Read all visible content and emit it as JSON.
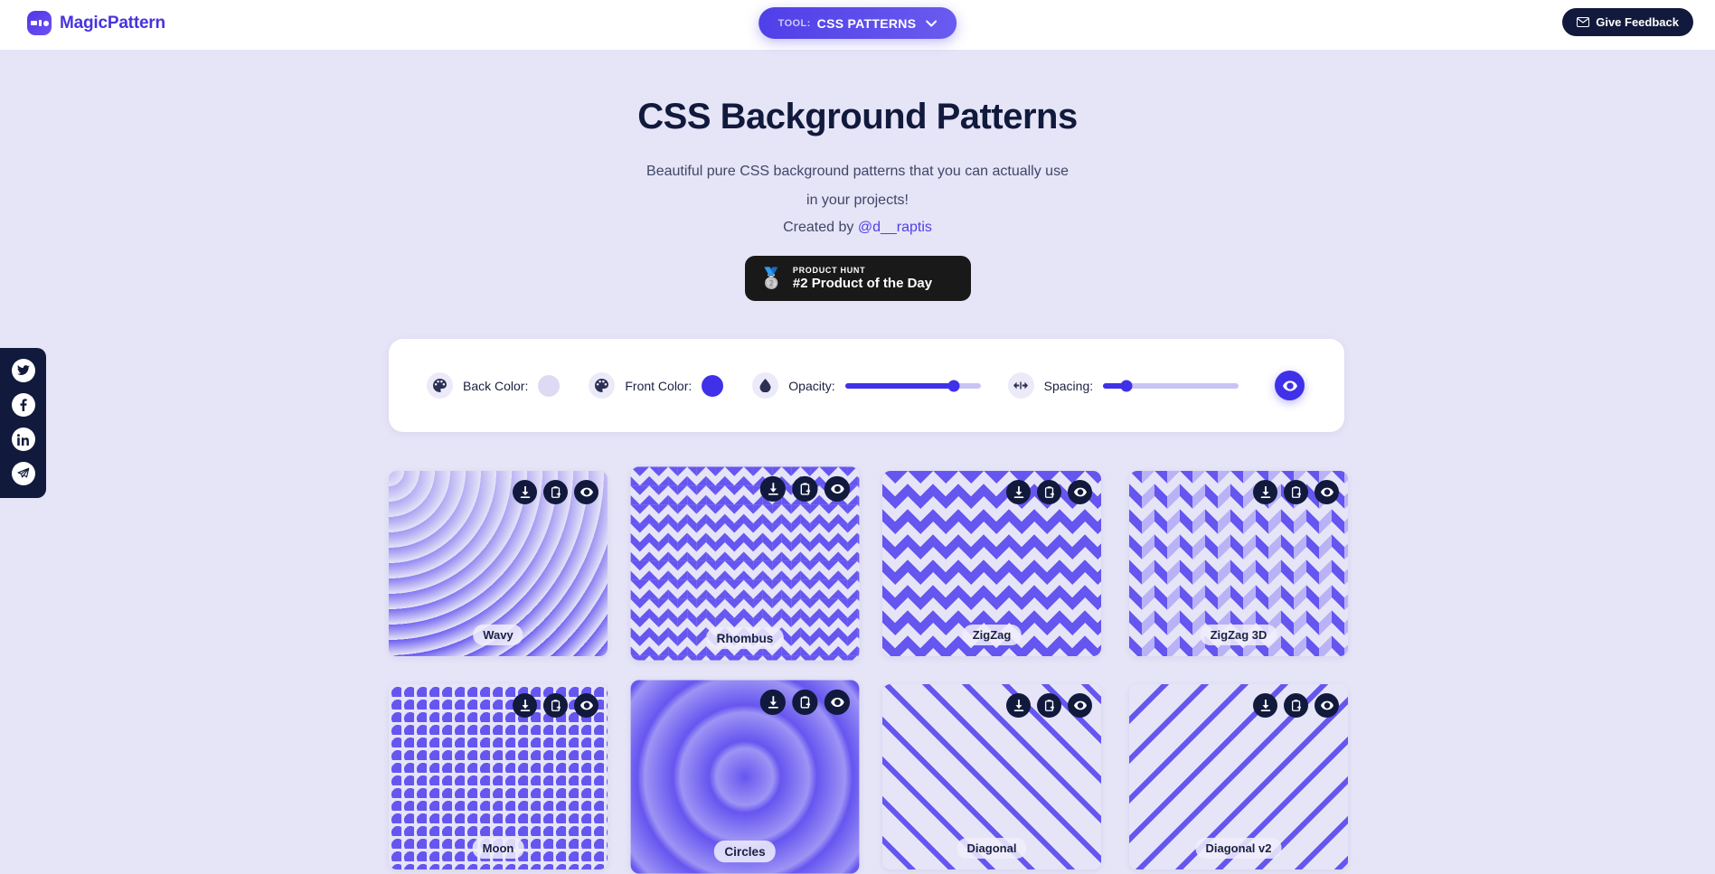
{
  "header": {
    "brand_name": "MagicPattern",
    "tool_label": "TOOL:",
    "tool_value": "CSS PATTERNS",
    "tool_chevron": "chevron-down-icon",
    "feedback_label": "Give Feedback",
    "feedback_icon": "envelope-icon"
  },
  "social": {
    "items": [
      {
        "name": "twitter",
        "glyph": "twitter-icon"
      },
      {
        "name": "facebook",
        "glyph": "facebook-icon"
      },
      {
        "name": "linkedin",
        "glyph": "linkedin-icon"
      },
      {
        "name": "telegram",
        "glyph": "telegram-icon"
      }
    ]
  },
  "hero": {
    "title": "CSS Background Patterns",
    "subtitle": "Beautiful pure CSS background patterns that you can actually use in your projects!",
    "created_prefix": "Created by ",
    "created_handle": "@d__raptis",
    "badge_kicker": "PRODUCT HUNT",
    "badge_title": "#2 Product of the Day",
    "badge_medal": "🥈"
  },
  "controls": {
    "back_color": {
      "label": "Back Color:",
      "value": "#dedaf4",
      "icon": "palette-icon"
    },
    "front_color": {
      "label": "Front Color:",
      "value": "#3f31e8",
      "icon": "palette-icon"
    },
    "opacity": {
      "label": "Opacity:",
      "icon": "droplet-icon",
      "value": 80,
      "min": 0,
      "max": 100
    },
    "spacing": {
      "label": "Spacing:",
      "icon": "horizontal-arrows-icon",
      "value": 17,
      "min": 0,
      "max": 100
    },
    "preview_icon": "eye-icon"
  },
  "card_actions": [
    {
      "name": "download",
      "icon": "download-icon"
    },
    {
      "name": "copy",
      "icon": "clipboard-copy-icon"
    },
    {
      "name": "preview",
      "icon": "eye-icon"
    }
  ],
  "patterns": [
    {
      "label": "Wavy",
      "css": "p-wavy",
      "hovered": false
    },
    {
      "label": "Rhombus",
      "css": "p-rhombus",
      "hovered": true
    },
    {
      "label": "ZigZag",
      "css": "p-zigzag",
      "hovered": false
    },
    {
      "label": "ZigZag 3D",
      "css": "p-zigzag3d",
      "hovered": false
    },
    {
      "label": "Moon",
      "css": "p-moon",
      "hovered": false
    },
    {
      "label": "Circles",
      "css": "p-circles",
      "hovered": true
    },
    {
      "label": "Diagonal",
      "css": "p-diagonal",
      "hovered": false
    },
    {
      "label": "Diagonal v2",
      "css": "p-diagonal2",
      "hovered": false
    }
  ],
  "theme": {
    "page_bg": "#e6e4f7",
    "accent": "#3f31e8",
    "dark": "#111a3c",
    "pattern_front": "#6656f0"
  }
}
